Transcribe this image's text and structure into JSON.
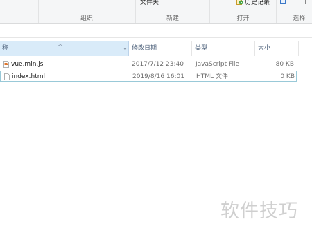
{
  "ribbon": {
    "top_label_file_folder": "文件夹",
    "history_label": "历史记录",
    "groups": [
      {
        "label": "组织"
      },
      {
        "label": "新建"
      },
      {
        "label": "打开"
      },
      {
        "label": "选择"
      }
    ]
  },
  "columns": {
    "name": "称",
    "date": "修改日期",
    "type": "类型",
    "size": "大小"
  },
  "files": [
    {
      "name": "vue.min.js",
      "date": "2017/7/12 23:40",
      "type": "JavaScript File",
      "size": "80 KB",
      "icon": "js-file-icon"
    },
    {
      "name": "index.html",
      "date": "2019/8/16 16:01",
      "type": "HTML 文件",
      "size": "0 KB",
      "icon": "html-file-icon"
    }
  ],
  "watermark": "软件技巧",
  "colors": {
    "header_selected": "#d9ebf9",
    "selection_border": "#99c9d8",
    "header_text": "#4c607a",
    "meta_text": "#6d6d6d"
  }
}
